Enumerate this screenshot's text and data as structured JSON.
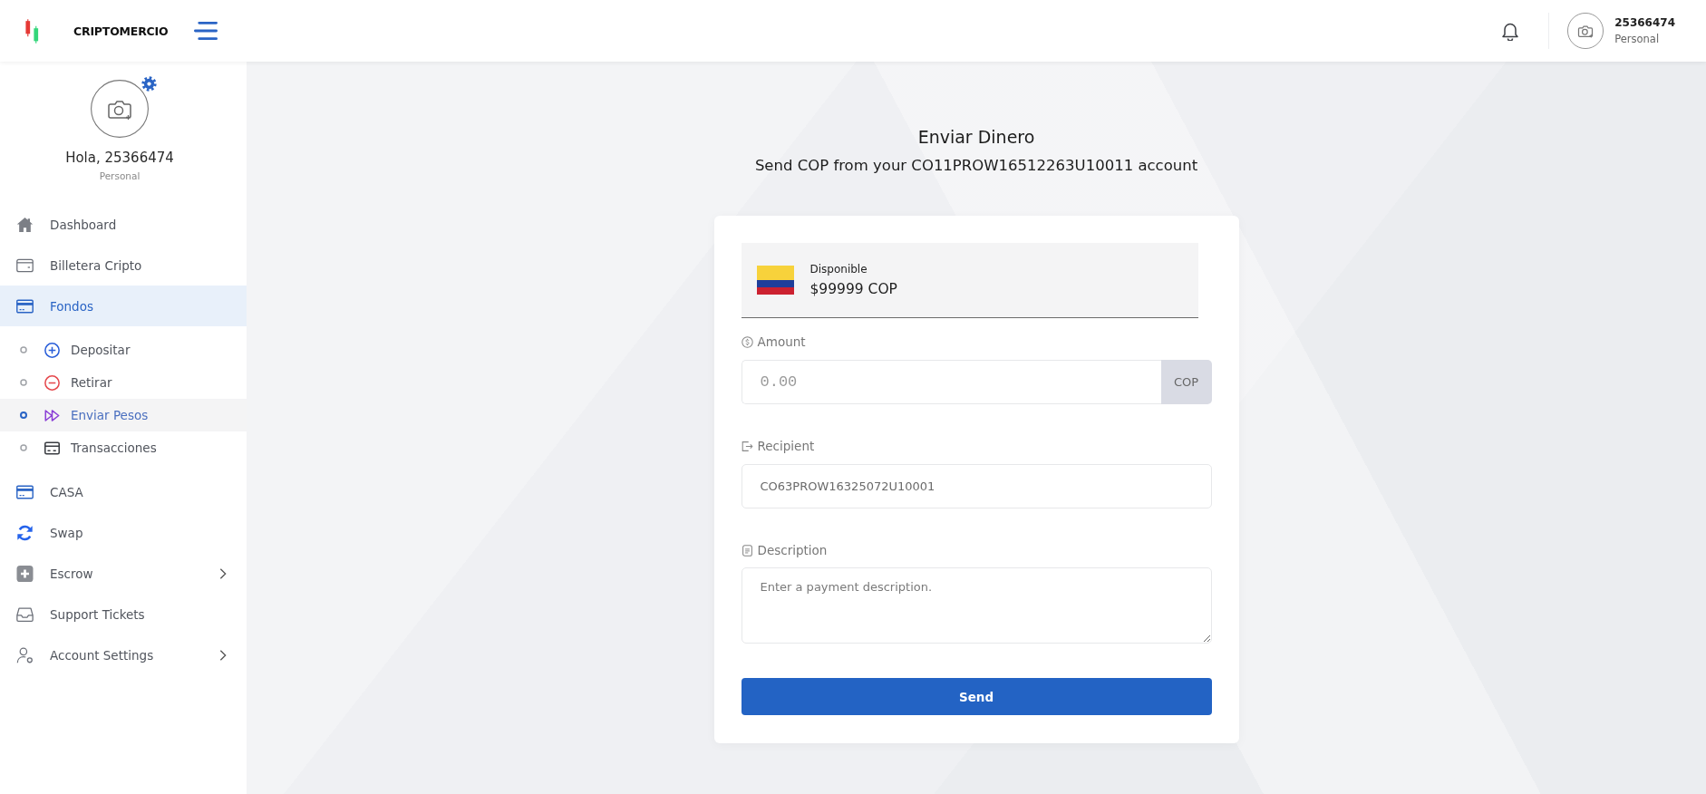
{
  "header": {
    "brand": "CRIPTOMERCIO",
    "user": {
      "name": "25366474",
      "role": "Personal"
    }
  },
  "sidebar": {
    "profile": {
      "greeting": "Hola, 25366474",
      "role": "Personal"
    },
    "items": [
      {
        "label": "Dashboard",
        "selected": false
      },
      {
        "label": "Billetera Cripto",
        "selected": false
      },
      {
        "label": "Fondos",
        "selected": true,
        "expanded": true,
        "children": [
          {
            "label": "Depositar",
            "selected": false
          },
          {
            "label": "Retirar",
            "selected": false
          },
          {
            "label": "Enviar Pesos",
            "selected": true
          },
          {
            "label": "Transacciones",
            "selected": false
          }
        ]
      },
      {
        "label": "CASA",
        "selected": false
      },
      {
        "label": "Swap",
        "selected": false
      },
      {
        "label": "Escrow",
        "selected": false,
        "expanded": false
      },
      {
        "label": "Support Tickets",
        "selected": false
      },
      {
        "label": "Account Settings",
        "selected": false,
        "expanded": false
      }
    ]
  },
  "form": {
    "title": "Enviar Dinero",
    "subtitle": "Send COP from your CO11PROW16512263U10011 account",
    "balance": {
      "label": "Disponible",
      "amount": "$99999 COP"
    },
    "fields": [
      {
        "kind": "amount",
        "label": "Amount",
        "placeholder": "0.00",
        "addon": "COP"
      },
      {
        "kind": "text",
        "label": "Recipient",
        "value": "CO63PROW16325072U10001"
      },
      {
        "kind": "textarea",
        "label": "Description",
        "placeholder": "Enter a payment description."
      }
    ],
    "submit": "Send"
  }
}
